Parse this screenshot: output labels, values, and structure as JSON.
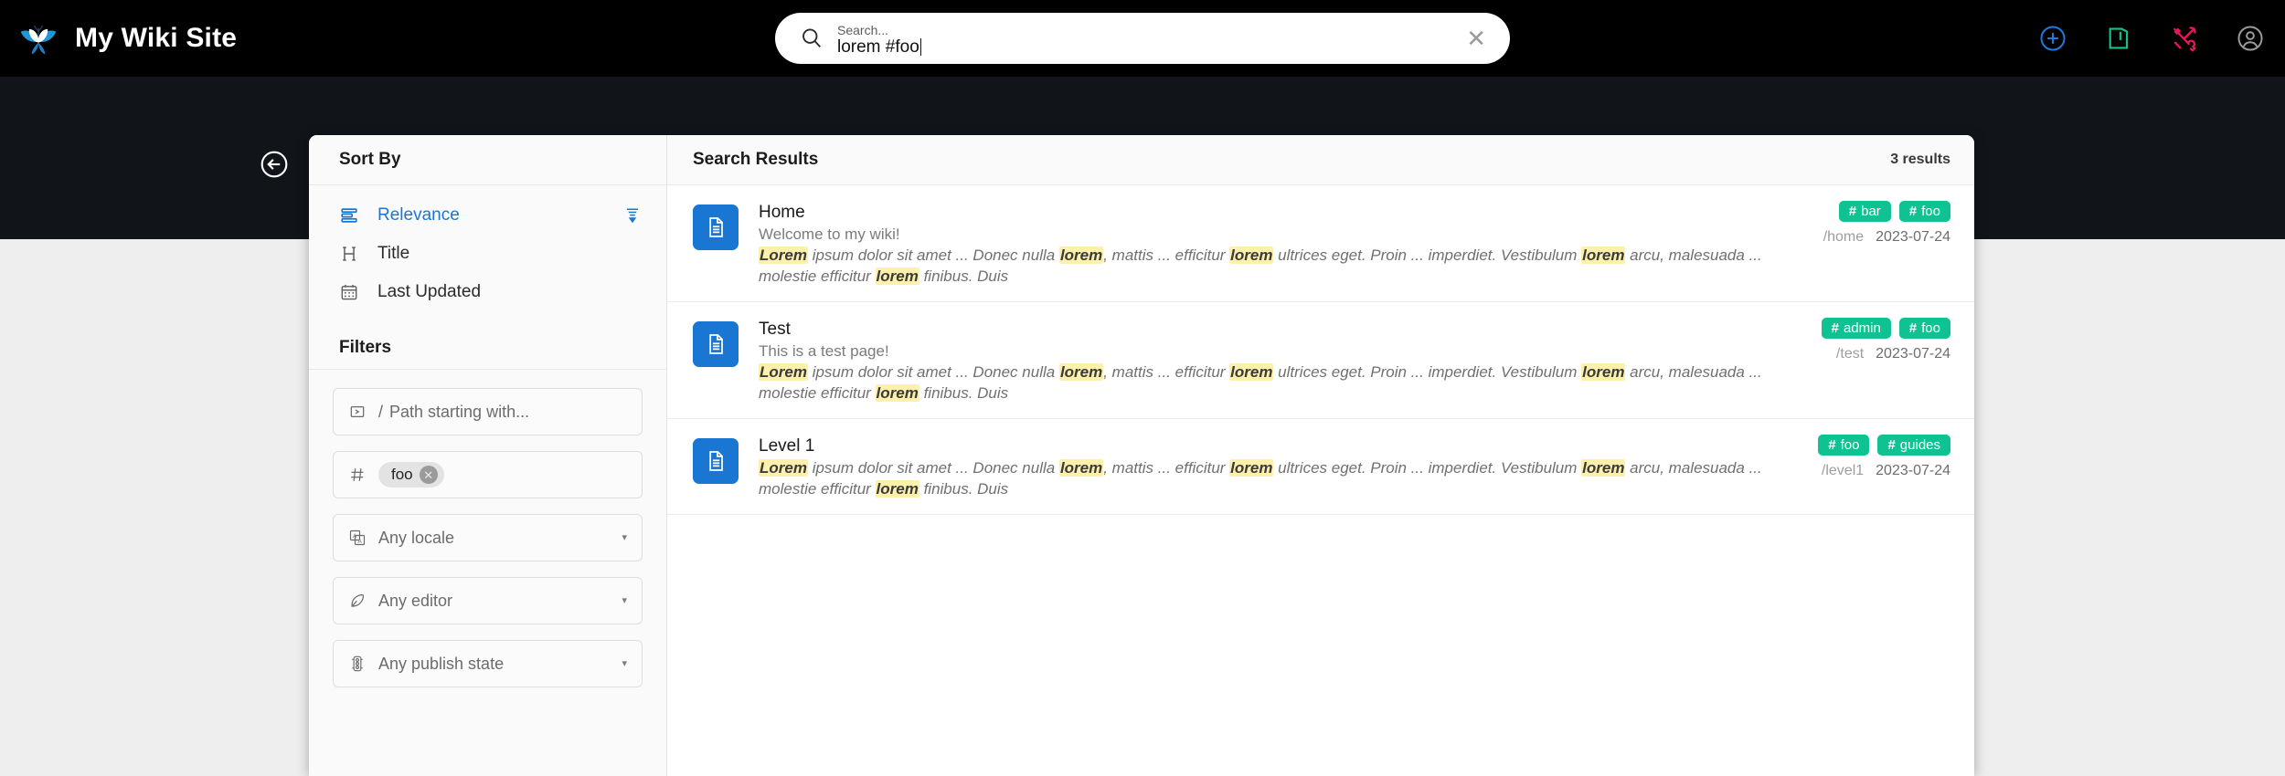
{
  "header": {
    "brand_title": "My Wiki Site",
    "logo_icon": "wiki-butterfly-logo",
    "search": {
      "icon": "search-icon",
      "label": "Search...",
      "value": "lorem #foo",
      "clear_icon": "close-icon",
      "clear_glyph": "✕"
    },
    "actions": [
      {
        "name": "new-page-button",
        "icon": "plus-circle-icon",
        "color": "#1f7ae0"
      },
      {
        "name": "page-actions-button",
        "icon": "book-page-icon",
        "color": "#0fc292"
      },
      {
        "name": "admin-tools-button",
        "icon": "tools-icon",
        "color": "#e8175d"
      },
      {
        "name": "account-button",
        "icon": "user-circle-icon",
        "color": "#9a9a9a"
      }
    ]
  },
  "back_button": {
    "icon": "arrow-left-circle-icon",
    "label": "Back"
  },
  "sidebar": {
    "sort_heading": "Sort By",
    "sort_options": [
      {
        "label": "Relevance",
        "icon": "sort-relevance-icon",
        "active": true,
        "direction_icon": "sort-descending-icon"
      },
      {
        "label": "Title",
        "icon": "heading-icon",
        "active": false
      },
      {
        "label": "Last Updated",
        "icon": "calendar-icon",
        "active": false
      }
    ],
    "filters_heading": "Filters",
    "filters": {
      "path": {
        "icon": "path-prompt-icon",
        "prefix": "/",
        "placeholder": "Path starting with..."
      },
      "tags": {
        "icon": "hash-icon",
        "chips": [
          {
            "label": "foo",
            "remove_glyph": "✕"
          }
        ]
      },
      "locale": {
        "icon": "translate-icon",
        "value": "Any locale",
        "chevron": "▾"
      },
      "editor": {
        "icon": "pen-nib-icon",
        "value": "Any editor",
        "chevron": "▾"
      },
      "publish_state": {
        "icon": "traffic-light-icon",
        "value": "Any publish state",
        "chevron": "▾"
      }
    }
  },
  "results": {
    "title": "Search Results",
    "count_label": "3 results",
    "items": [
      {
        "icon": "document-icon",
        "title": "Home",
        "description": "Welcome to my wiki!",
        "snippet_parts": [
          {
            "t": "Lorem",
            "hl": true
          },
          {
            "t": " ipsum dolor sit amet ... Donec nulla ",
            "hl": false
          },
          {
            "t": "lorem",
            "hl": true
          },
          {
            "t": ", mattis ... efficitur ",
            "hl": false
          },
          {
            "t": "lorem",
            "hl": true
          },
          {
            "t": " ultrices eget. Proin ... imperdiet. Vestibulum ",
            "hl": false
          },
          {
            "t": "lorem",
            "hl": true
          },
          {
            "t": " arcu, malesuada ... molestie efficitur ",
            "hl": false
          },
          {
            "t": "lorem",
            "hl": true
          },
          {
            "t": " finibus. Duis",
            "hl": false
          }
        ],
        "tags": [
          "bar",
          "foo"
        ],
        "path": "/home",
        "date": "2023-07-24"
      },
      {
        "icon": "document-icon",
        "title": "Test",
        "description": "This is a test page!",
        "snippet_parts": [
          {
            "t": "Lorem",
            "hl": true
          },
          {
            "t": " ipsum dolor sit amet ... Donec nulla ",
            "hl": false
          },
          {
            "t": "lorem",
            "hl": true
          },
          {
            "t": ", mattis ... efficitur ",
            "hl": false
          },
          {
            "t": "lorem",
            "hl": true
          },
          {
            "t": " ultrices eget. Proin ... imperdiet. Vestibulum ",
            "hl": false
          },
          {
            "t": "lorem",
            "hl": true
          },
          {
            "t": " arcu, malesuada ... molestie efficitur ",
            "hl": false
          },
          {
            "t": "lorem",
            "hl": true
          },
          {
            "t": " finibus. Duis",
            "hl": false
          }
        ],
        "tags": [
          "admin",
          "foo"
        ],
        "path": "/test",
        "date": "2023-07-24"
      },
      {
        "icon": "document-icon",
        "title": "Level 1",
        "description": "",
        "snippet_parts": [
          {
            "t": "Lorem",
            "hl": true
          },
          {
            "t": " ipsum dolor sit amet ... Donec nulla ",
            "hl": false
          },
          {
            "t": "lorem",
            "hl": true
          },
          {
            "t": ", mattis ... efficitur ",
            "hl": false
          },
          {
            "t": "lorem",
            "hl": true
          },
          {
            "t": " ultrices eget. Proin ... imperdiet. Vestibulum ",
            "hl": false
          },
          {
            "t": "lorem",
            "hl": true
          },
          {
            "t": " arcu, malesuada ... molestie efficitur ",
            "hl": false
          },
          {
            "t": "lorem",
            "hl": true
          },
          {
            "t": " finibus. Duis",
            "hl": false
          }
        ],
        "tags": [
          "foo",
          "guides"
        ],
        "path": "/level1",
        "date": "2023-07-24"
      }
    ]
  },
  "colors": {
    "header_bg": "#000000",
    "banner_bg": "#111419",
    "page_bg": "#eeeeee",
    "accent_blue": "#1976d2",
    "tag_green": "#0fc292",
    "highlight_yellow": "#fdf0ab"
  }
}
